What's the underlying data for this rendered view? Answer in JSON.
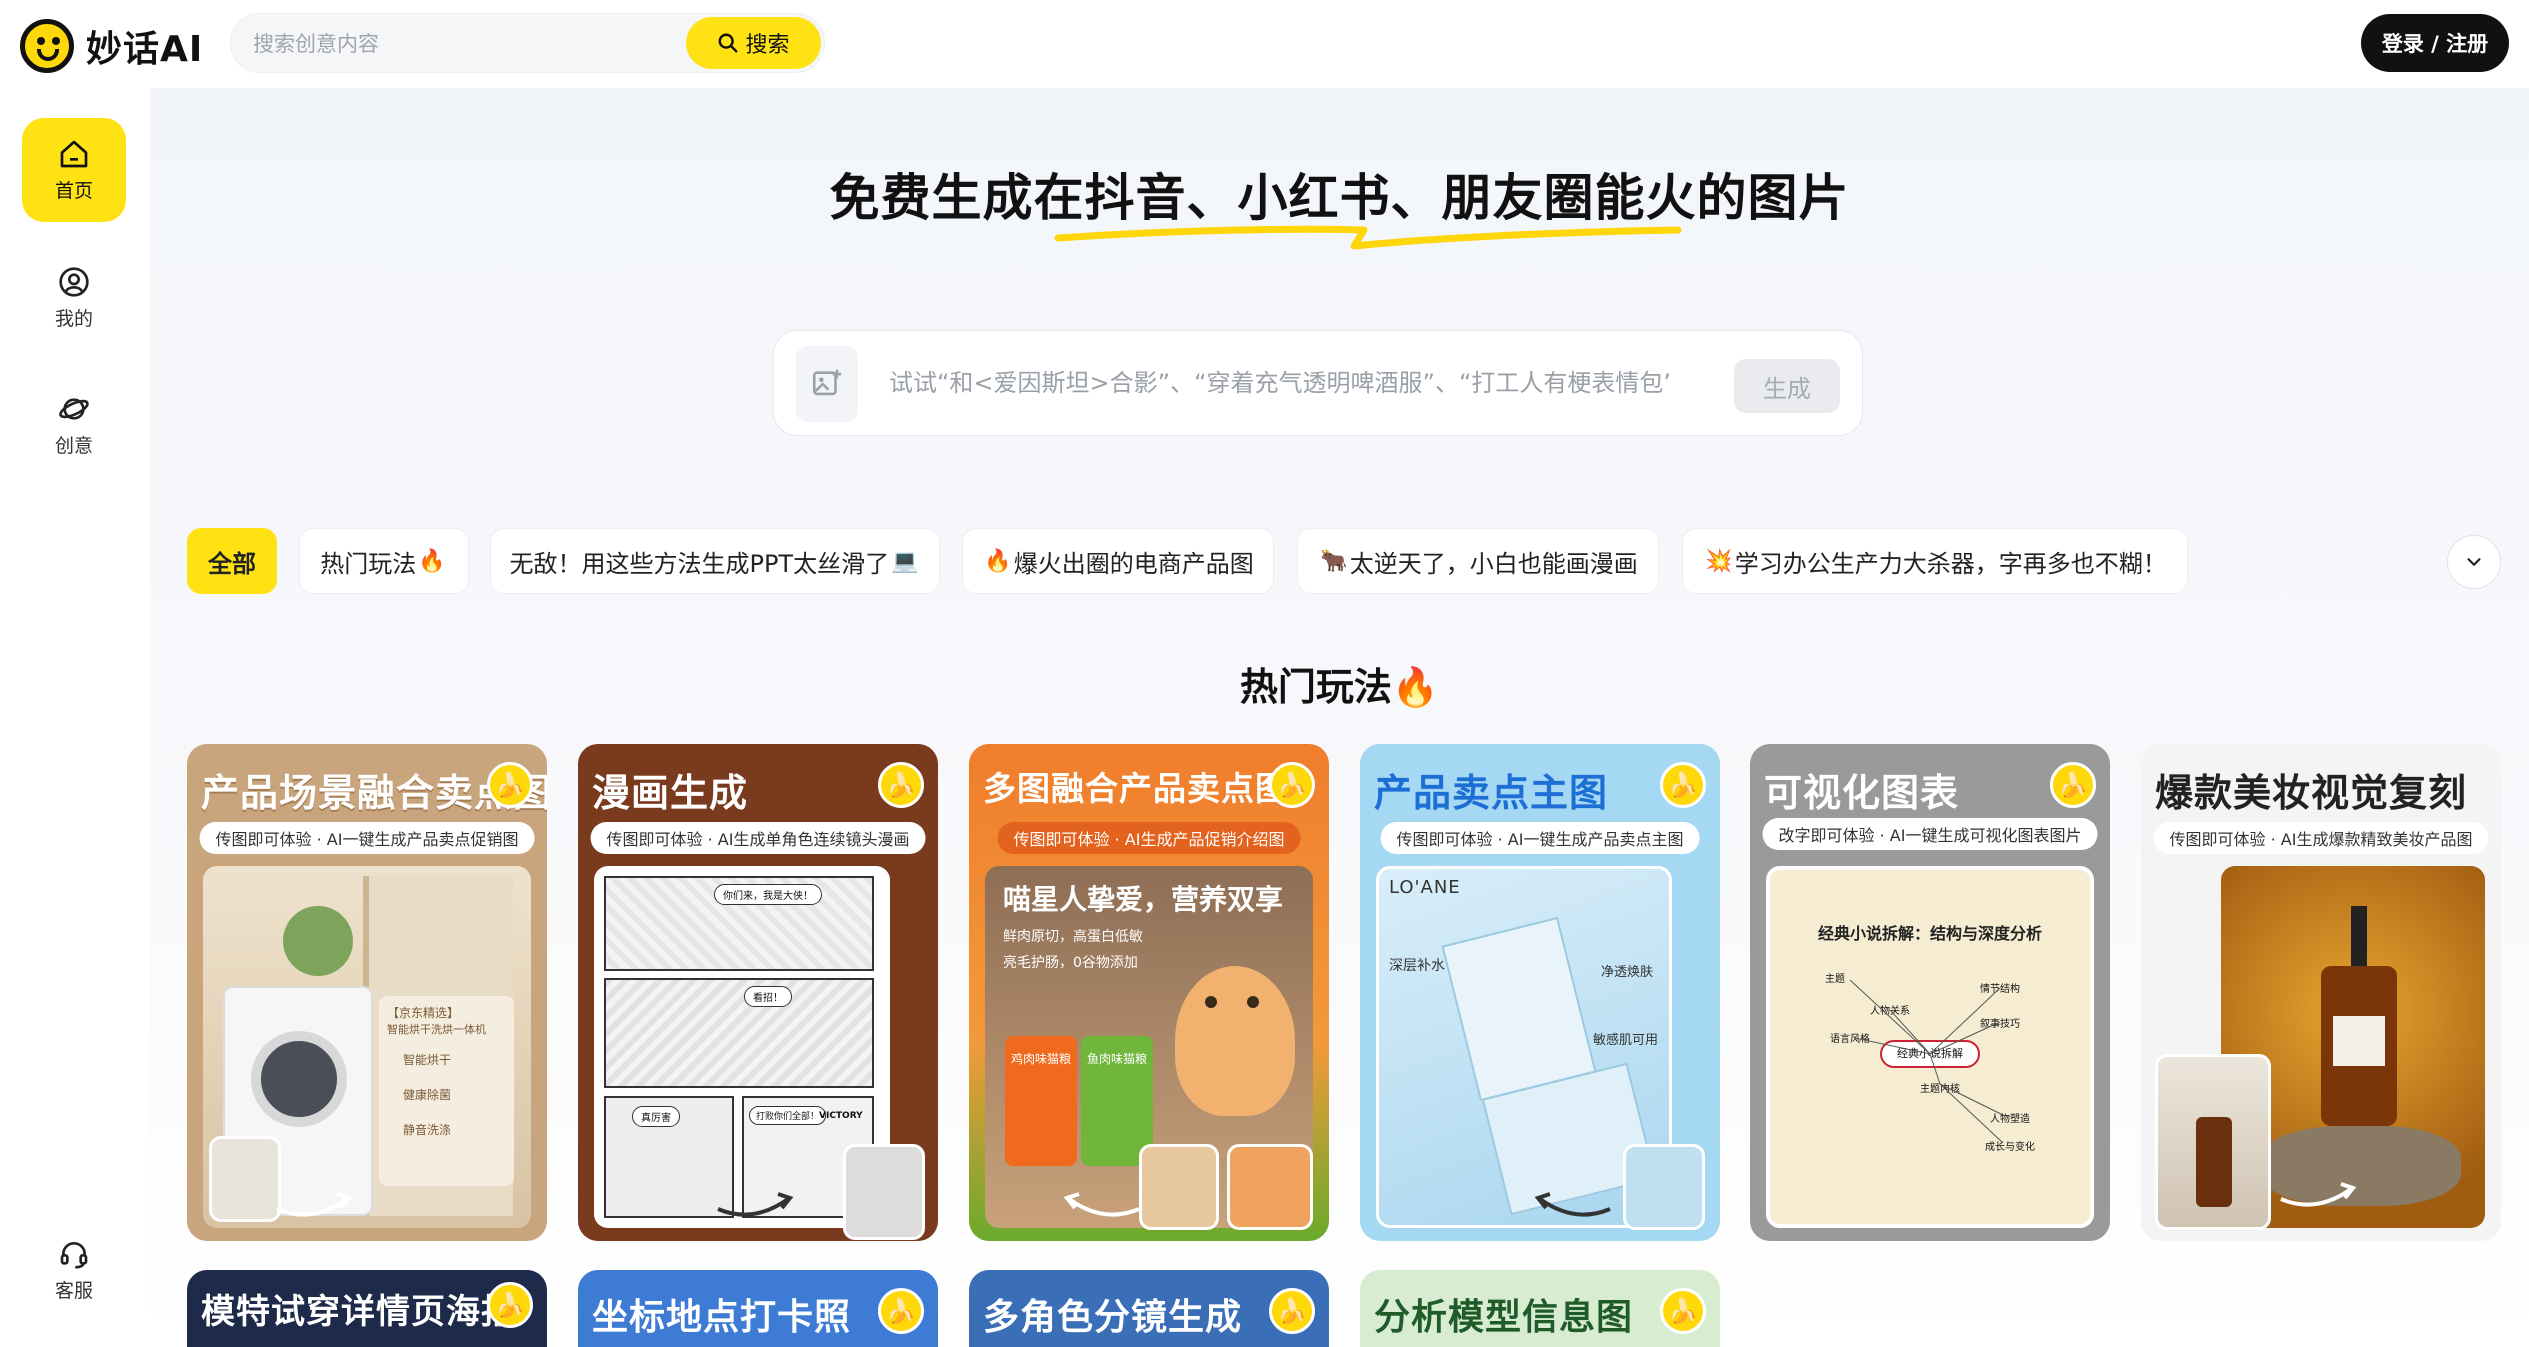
{
  "header": {
    "logo_text": "妙话AI",
    "search_placeholder": "搜索创意内容",
    "search_button": "搜索",
    "login_button": "登录 / 注册"
  },
  "sidebar": {
    "items": [
      {
        "label": "首页",
        "icon": "home-icon"
      },
      {
        "label": "我的",
        "icon": "user-icon"
      },
      {
        "label": "创意",
        "icon": "planet-icon"
      }
    ],
    "support": {
      "label": "客服",
      "icon": "headset-icon"
    }
  },
  "hero": {
    "title": "免费生成在抖音、小红书、朋友圈能火的图片",
    "prompt_placeholder": "试试“和<爱因斯坦>合影”、“穿着充气透明啤酒服”、“打工人有梗表情包”...",
    "generate_button": "生成"
  },
  "tabs": [
    {
      "label": "全部",
      "emoji": ""
    },
    {
      "label": "热门玩法",
      "emoji": "🔥"
    },
    {
      "label": "无敌！用这些方法生成PPT太丝滑了",
      "emoji": "💻"
    },
    {
      "label": "爆火出圈的电商产品图",
      "emoji": "🔥"
    },
    {
      "label": "太逆天了，小白也能画漫画",
      "emoji": "🐂"
    },
    {
      "label": "学习办公生产力大杀器，字再多也不糊！",
      "emoji": "💥"
    }
  ],
  "section": {
    "title": "热门玩法",
    "emoji": "🔥"
  },
  "cards": [
    {
      "title": "产品场景融合卖点图",
      "subtitle": "传图即可体验 · AI一键生成产品卖点促销图",
      "colors": {
        "bg": "#c9a57e",
        "title": "#ffffff"
      },
      "detail": {
        "brand": "【京东精选】",
        "desc": "智能烘干洗烘一体机",
        "features": [
          "智能烘干",
          "健康除菌",
          "静音洗涤"
        ]
      }
    },
    {
      "title": "漫画生成",
      "subtitle": "传图即可体验 · AI生成单角色连续镜头漫画",
      "colors": {
        "bg": "#7a3a1e",
        "title": "#ffffff"
      },
      "detail": {
        "bubbles": [
          "你们来，我是大侠！",
          "看招！",
          "真厉害",
          "打败你们全部！",
          "VICTORY"
        ]
      }
    },
    {
      "title": "多图融合产品卖点图",
      "subtitle": "传图即可体验 · AI生成产品促销介绍图",
      "colors": {
        "bg": "#f07d2c",
        "title": "#ffffff"
      },
      "detail": {
        "headline": "喵星人挚爱，营养双享",
        "points": [
          "鲜肉原切，高蛋白低敏",
          "亮毛护肠，0谷物添加"
        ],
        "bags": [
          "鸡肉味猫粮",
          "鱼肉味猫粮"
        ]
      }
    },
    {
      "title": "产品卖点主图",
      "subtitle": "传图即可体验 · AI一键生成产品卖点主图",
      "colors": {
        "bg": "#a5d8f2",
        "title": "#1d6fd6"
      },
      "detail": {
        "brand": "LO'ANE",
        "features": [
          "深层补水",
          "净透焕肤",
          "敏感肌可用"
        ]
      }
    },
    {
      "title": "可视化图表",
      "subtitle": "改字即可体验 · AI一键生成可视化图表图片",
      "colors": {
        "bg": "#9a9a9a",
        "title": "#ffffff"
      },
      "detail": {
        "heading": "经典小说拆解：结构与深度分析",
        "center": "经典小说拆解",
        "branches": [
          "主题",
          "情节结构",
          "人物关系",
          "叙事技巧",
          "语言风格",
          "主题内核",
          "人物塑造",
          "成长与变化"
        ]
      }
    },
    {
      "title": "爆款美妆视觉复刻",
      "subtitle": "传图即可体验 · AI生成爆款精致美妆产品图",
      "colors": {
        "bg": "#f4f4f4",
        "title": "#222222"
      },
      "detail": {}
    },
    {
      "title": "模特试穿详情页海报",
      "colors": {
        "bg": "#1e2a4a",
        "title": "#ffffff"
      }
    },
    {
      "title": "坐标地点打卡照",
      "colors": {
        "bg": "#3e7bd4",
        "title": "#ffffff"
      }
    },
    {
      "title": "多角色分镜生成",
      "colors": {
        "bg": "#3a6fb8",
        "title": "#ffffff"
      }
    },
    {
      "title": "分析模型信息图",
      "colors": {
        "bg": "#d8ecd2",
        "title": "#1f5c2a"
      }
    }
  ]
}
